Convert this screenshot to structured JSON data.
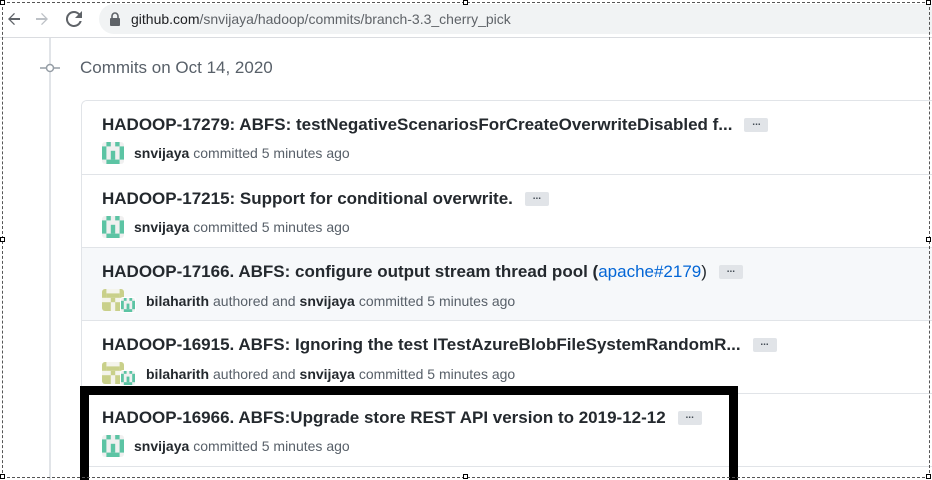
{
  "browser": {
    "url_host": "github.com",
    "url_path": "/snvijaya/hadoop/commits/branch-3.3_cherry_pick"
  },
  "timeline": {
    "date_heading": "Commits on Oct 14, 2020"
  },
  "commits": [
    {
      "message": "HADOOP-17279: ABFS: testNegativeScenariosForCreateOverwriteDisabled f...",
      "author": "snvijaya",
      "action": "committed 5 minutes ago",
      "avatar": "snvijaya-identicon"
    },
    {
      "message": "HADOOP-17215: Support for conditional overwrite.",
      "author": "snvijaya",
      "action": "committed 5 minutes ago",
      "avatar": "snvijaya-identicon"
    },
    {
      "message": "HADOOP-17166. ABFS: configure output stream thread pool (",
      "link": "apache#2179",
      "message_end": ")",
      "author": "bilaharith",
      "authored_text": "authored and",
      "committer": "snvijaya",
      "action": "committed 5 minutes ago",
      "avatar": "bilaharith-identicon"
    },
    {
      "message": "HADOOP-16915. ABFS: Ignoring the test ITestAzureBlobFileSystemRandomR...",
      "author": "bilaharith",
      "authored_text": "authored and",
      "committer": "snvijaya",
      "action": "committed 5 minutes ago",
      "avatar": "bilaharith-identicon"
    },
    {
      "message": "HADOOP-16966. ABFS:Upgrade store REST API version to 2019-12-12",
      "author": "snvijaya",
      "action": "committed 5 minutes ago",
      "avatar": "snvijaya-identicon"
    }
  ],
  "ellipsis_label": "...",
  "colors": {
    "link": "#0366d6",
    "highlight_border": "#000000",
    "snvijaya_identicon": "#5cc4a4",
    "bilaharith_identicon": "#c9d08a"
  }
}
